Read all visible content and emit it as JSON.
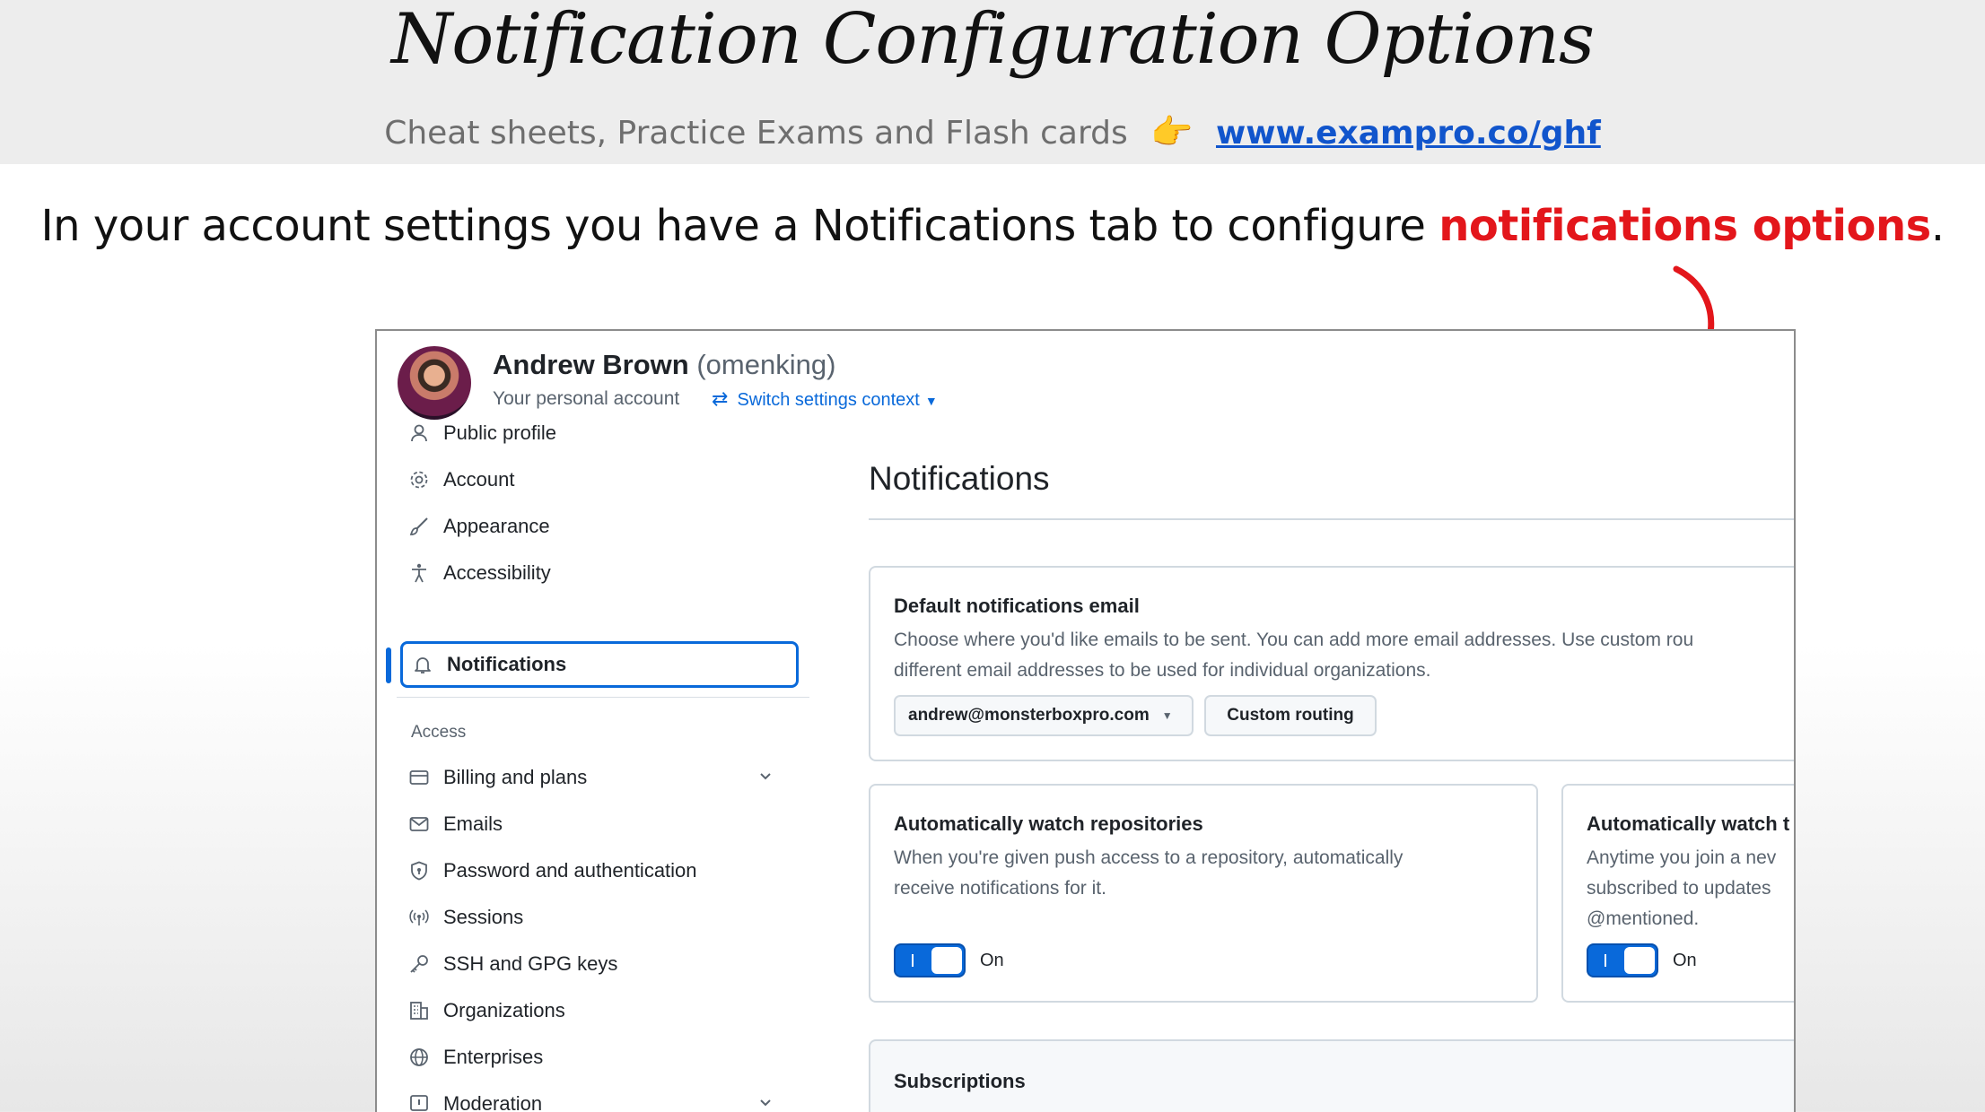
{
  "slide": {
    "title": "Notification Configuration Options",
    "subtitle_text": "Cheat sheets, Practice Exams and Flash cards",
    "subtitle_link": "www.exampro.co/ghf",
    "intro_text": "In your account settings you have a Notifications tab to configure ",
    "intro_highlight": "notifications options",
    "intro_end": ".",
    "colors": {
      "highlight": "#e3161b",
      "link": "#1155cc"
    }
  },
  "account": {
    "name": "Andrew Brown",
    "login": "(omenking)",
    "subtitle": "Your personal account",
    "switch_label": "Switch settings context"
  },
  "sidebar": {
    "items": [
      {
        "label": "Public profile",
        "icon": "person-icon"
      },
      {
        "label": "Account",
        "icon": "gear-icon"
      },
      {
        "label": "Appearance",
        "icon": "paintbrush-icon"
      },
      {
        "label": "Accessibility",
        "icon": "accessibility-icon"
      },
      {
        "label": "Notifications",
        "icon": "bell-icon",
        "selected": true
      }
    ],
    "group_label": "Access",
    "access_items": [
      {
        "label": "Billing and plans",
        "icon": "credit-card-icon",
        "expandable": true
      },
      {
        "label": "Emails",
        "icon": "mail-icon"
      },
      {
        "label": "Password and authentication",
        "icon": "shield-lock-icon"
      },
      {
        "label": "Sessions",
        "icon": "broadcast-icon"
      },
      {
        "label": "SSH and GPG keys",
        "icon": "key-icon"
      },
      {
        "label": "Organizations",
        "icon": "organization-icon"
      },
      {
        "label": "Enterprises",
        "icon": "globe-icon"
      },
      {
        "label": "Moderation",
        "icon": "report-icon",
        "expandable": true
      }
    ]
  },
  "main": {
    "title": "Notifications",
    "default_email": {
      "title": "Default notifications email",
      "desc_line1": "Choose where you'd like emails to be sent. You can add more email addresses. Use custom rou",
      "desc_line2": "different email addresses to be used for individual organizations.",
      "email_value": "andrew@monsterboxpro.com",
      "custom_routing_label": "Custom routing"
    },
    "watch_repos": {
      "title": "Automatically watch repositories",
      "desc_line1": "When you're given push access to a repository, automatically",
      "desc_line2": "receive notifications for it.",
      "toggle_label": "On",
      "enabled": true
    },
    "watch_teams": {
      "title": "Automatically watch t",
      "desc_line1": "Anytime you join a nev",
      "desc_line2": "subscribed to updates",
      "desc_line3": "@mentioned.",
      "toggle_label": "On",
      "enabled": true
    },
    "subscriptions": {
      "title": "Subscriptions"
    }
  }
}
